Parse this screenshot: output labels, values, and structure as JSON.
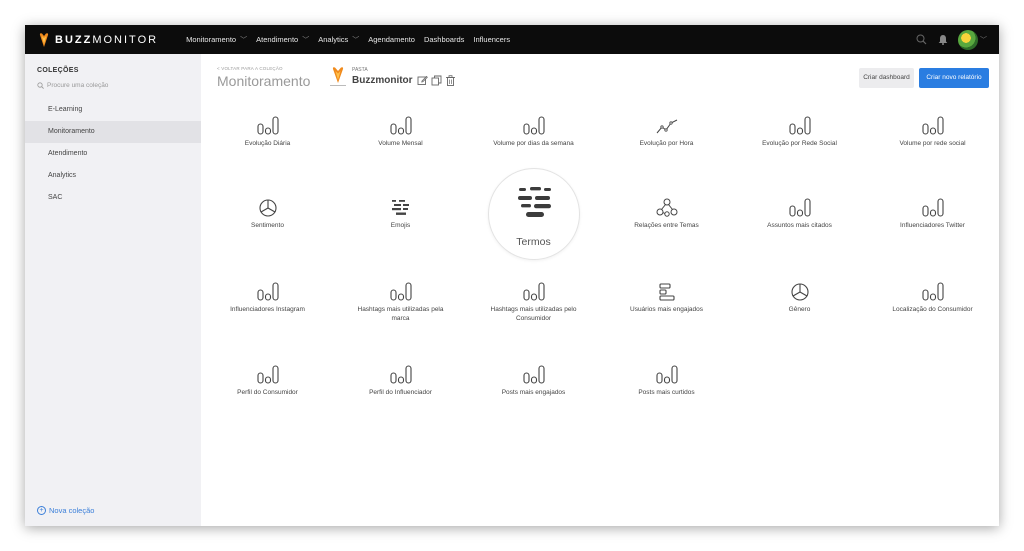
{
  "app": {
    "logo_bold": "BUZZ",
    "logo_light": "MONITOR"
  },
  "nav": [
    {
      "label": "Monitoramento",
      "has_dropdown": true
    },
    {
      "label": "Atendimento",
      "has_dropdown": true
    },
    {
      "label": "Analytics",
      "has_dropdown": true
    },
    {
      "label": "Agendamento",
      "has_dropdown": false
    },
    {
      "label": "Dashboards",
      "has_dropdown": false
    },
    {
      "label": "Influencers",
      "has_dropdown": false
    }
  ],
  "topbar_icons": [
    "search-icon",
    "bell-icon",
    "avatar"
  ],
  "sidebar": {
    "title": "COLEÇÕES",
    "search_placeholder": "Procure uma coleção",
    "items": [
      {
        "label": "E-Learning",
        "active": false
      },
      {
        "label": "Monitoramento",
        "active": true
      },
      {
        "label": "Atendimento",
        "active": false
      },
      {
        "label": "Analytics",
        "active": false
      },
      {
        "label": "SAC",
        "active": false
      }
    ],
    "new_collection": "Nova coleção"
  },
  "header": {
    "back_link": "< VOLTAR PARA A COLEÇÃO",
    "title": "Monitoramento",
    "folder_label": "PASTA",
    "folder_name": "Buzzmonitor",
    "folder_actions": [
      "edit-icon",
      "copy-icon",
      "trash-icon"
    ],
    "create_dashboard": "Criar dashboard",
    "create_report": "Criar novo relatório"
  },
  "tiles": [
    {
      "label": "Evolução Diária",
      "icon": "bar-chart-icon"
    },
    {
      "label": "Volume Mensal",
      "icon": "bar-chart-icon"
    },
    {
      "label": "Volume por dias da semana",
      "icon": "bar-chart-icon"
    },
    {
      "label": "Evolução por Hora",
      "icon": "line-chart-icon"
    },
    {
      "label": "Evolução por Rede Social",
      "icon": "bar-chart-icon"
    },
    {
      "label": "Volume por rede social",
      "icon": "bar-chart-icon"
    },
    {
      "label": "Sentimento",
      "icon": "pie-chart-icon"
    },
    {
      "label": "Emojis",
      "icon": "word-cloud-icon"
    },
    {
      "label": "Termos",
      "icon": "word-cloud-icon",
      "featured": true
    },
    {
      "label": "Relações entre Temas",
      "icon": "network-icon"
    },
    {
      "label": "Assuntos mais citados",
      "icon": "bar-chart-icon"
    },
    {
      "label": "Influenciadores Twitter",
      "icon": "bar-chart-icon"
    },
    {
      "label": "Influenciadores Instagram",
      "icon": "bar-chart-icon"
    },
    {
      "label": "Hashtags mais utilizadas pela marca",
      "icon": "bar-chart-icon"
    },
    {
      "label": "Hashtags mais utilizadas pelo Consumidor",
      "icon": "bar-chart-icon"
    },
    {
      "label": "Usuários mais engajados",
      "icon": "horizontal-bar-icon"
    },
    {
      "label": "Gênero",
      "icon": "pie-chart-icon"
    },
    {
      "label": "Localização do Consumidor",
      "icon": "bar-chart-icon"
    },
    {
      "label": "Perfil do Consumidor",
      "icon": "bar-chart-icon"
    },
    {
      "label": "Perfil do Influenciador",
      "icon": "bar-chart-icon"
    },
    {
      "label": "Posts mais engajados",
      "icon": "bar-chart-icon"
    },
    {
      "label": "Posts mais curtidos",
      "icon": "bar-chart-icon"
    }
  ],
  "colors": {
    "topbar": "#0c0c0c",
    "primary": "#2a7de1",
    "link": "#3b7fd9",
    "flame": "#f08a1c"
  }
}
